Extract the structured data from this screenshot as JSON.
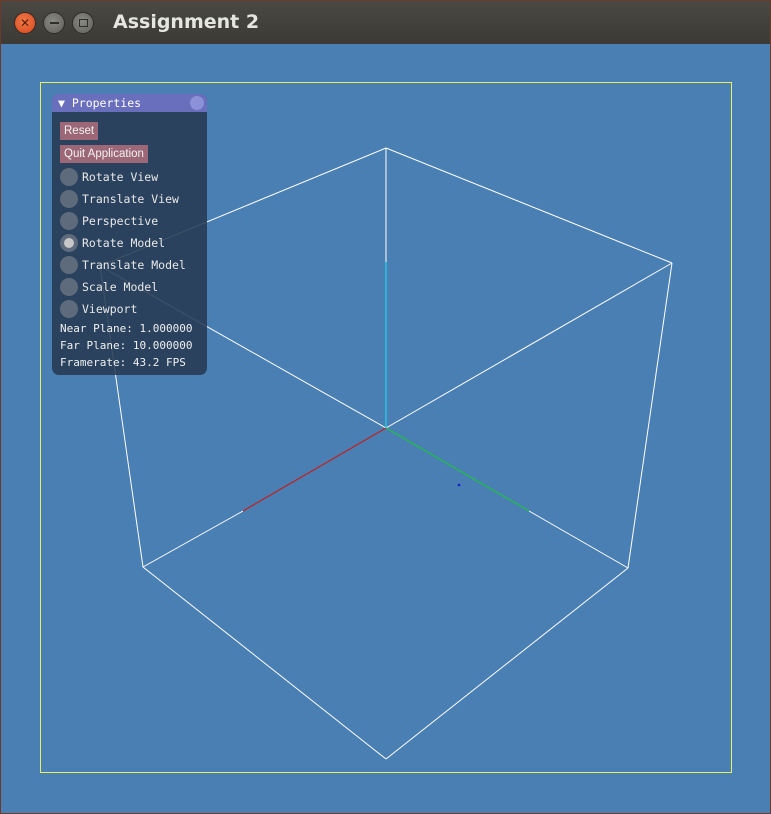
{
  "window": {
    "title": "Assignment 2",
    "close_icon": "close-icon",
    "minimize_icon": "minimize-icon",
    "maximize_icon": "maximize-icon"
  },
  "panel": {
    "header": "▼ Properties",
    "buttons": {
      "reset": "Reset",
      "quit": "Quit Application"
    },
    "modes": [
      {
        "label": "Rotate View",
        "checked": false
      },
      {
        "label": "Translate View",
        "checked": false
      },
      {
        "label": "Perspective",
        "checked": false
      },
      {
        "label": "Rotate Model",
        "checked": true
      },
      {
        "label": "Translate Model",
        "checked": false
      },
      {
        "label": "Scale Model",
        "checked": false
      },
      {
        "label": "Viewport",
        "checked": false
      }
    ],
    "info": {
      "near": "Near Plane: 1.000000",
      "far": "Far Plane: 10.000000",
      "fps": "Framerate: 43.2 FPS"
    }
  },
  "colors": {
    "background": "#4a7fb4",
    "viewport_border": "#e6f060",
    "cube_edges": "#ffffff",
    "axis_x": "#c0201e",
    "axis_y": "#22d0ee",
    "axis_z": "#20c040"
  }
}
